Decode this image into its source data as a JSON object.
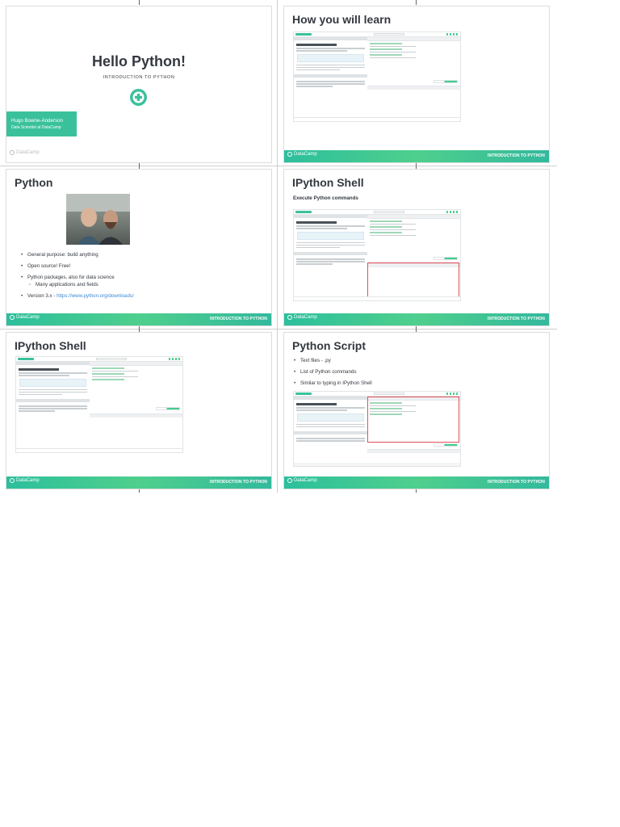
{
  "footer": {
    "brand": "DataCamp",
    "course": "INTRODUCTION TO PYTHON"
  },
  "slides": {
    "title": {
      "heading": "Hello Python!",
      "subheading": "INTRODUCTION TO PYTHON",
      "presenter_name": "Hugo Bowne-Anderson",
      "presenter_role": "Data Scientist at DataCamp",
      "brand": "DataCamp"
    },
    "learn": {
      "title": "How you will learn"
    },
    "python": {
      "title": "Python",
      "bullets": [
        "General purpose: build anything",
        "Open source! Free!",
        "Python packages, also for data science"
      ],
      "sub_bullet": "Many applications and fields",
      "version_prefix": "Version 3.x - ",
      "version_link": "https://www.python.org/downloads/"
    },
    "ipython1": {
      "title": "IPython Shell",
      "subtitle": "Execute Python commands"
    },
    "ipython2": {
      "title": "IPython Shell"
    },
    "script": {
      "title": "Python Script",
      "bullets": [
        "Text files - .py",
        "List of Python commands",
        "Similar to typing in IPython Shell"
      ]
    }
  },
  "colors": {
    "accent": "#3ac19c",
    "footer": "#4fcf8d",
    "link": "#3a8ad6",
    "highlight": "#e0505a"
  }
}
